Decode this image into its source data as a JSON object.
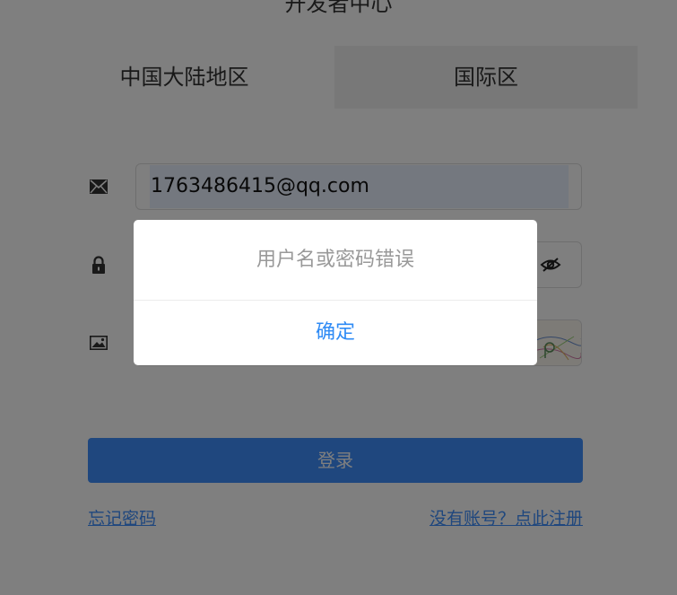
{
  "page": {
    "title": "开发者中心"
  },
  "tabs": [
    {
      "label": "中国大陆地区",
      "active": true
    },
    {
      "label": "国际区",
      "active": false
    }
  ],
  "form": {
    "email": {
      "value": "1763486415@qq.com",
      "icon": "mail-icon"
    },
    "password": {
      "value": "",
      "icon": "lock-icon",
      "toggle_icon": "eye-off-icon"
    },
    "captcha": {
      "value": "",
      "icon": "image-icon"
    },
    "login_label": "登录",
    "forgot_label": "忘记密码",
    "register_label": "没有账号？点此注册"
  },
  "dialog": {
    "message": "用户名或密码错误",
    "confirm_label": "确定"
  },
  "colors": {
    "accent": "#3f8efc",
    "dialog_button": "#2f8bf5",
    "overlay": "rgba(0,0,0,0.5)"
  }
}
